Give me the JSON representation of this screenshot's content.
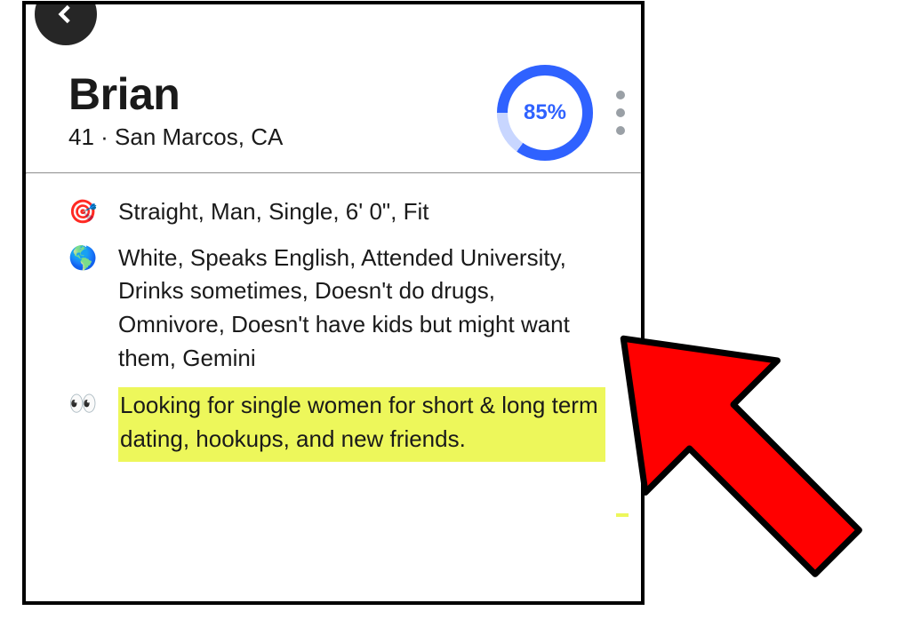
{
  "profile": {
    "name": "Brian",
    "subline": "41 · San Marcos, CA",
    "match_percent": "85%",
    "match_percent_value": 85
  },
  "details": {
    "basics": {
      "icon": "🎯",
      "text": "Straight, Man, Single, 6' 0\", Fit"
    },
    "background": {
      "icon": "🌎",
      "text": "White, Speaks English, Attended University, Drinks sometimes, Doesn't do drugs, Omnivore, Doesn't have kids but might want them, Gemini"
    },
    "looking_for": {
      "icon": "👀",
      "text": "Looking for single women for short & long term dating, hookups, and new friends."
    }
  },
  "colors": {
    "highlight": "#edf75b",
    "ring_fg": "#2f62ff",
    "ring_bg": "#c8d6ff",
    "arrow": "#ff0000"
  }
}
